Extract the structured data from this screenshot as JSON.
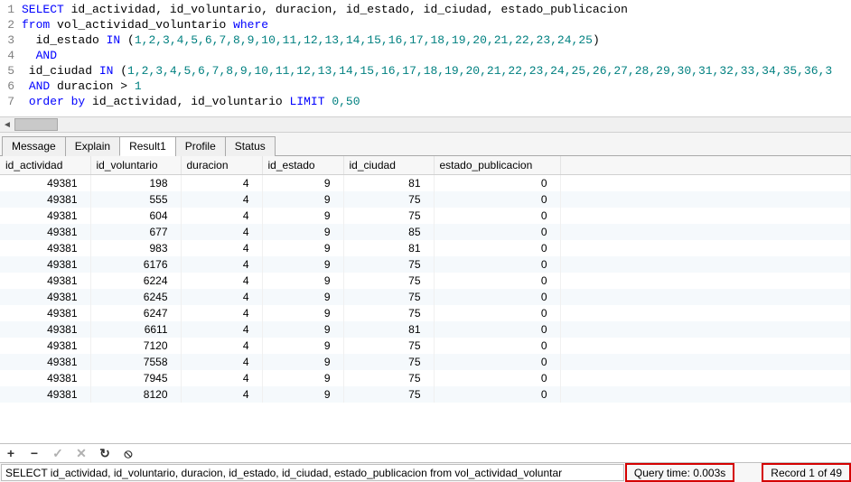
{
  "sql_lines": [
    {
      "n": "1",
      "tokens": [
        {
          "t": "SELECT",
          "c": "kw"
        },
        {
          "t": " id_actividad, id_voluntario, duracion, id_estado, id_ciudad, estado_publicacion"
        }
      ]
    },
    {
      "n": "2",
      "tokens": [
        {
          "t": "from",
          "c": "kw"
        },
        {
          "t": " vol_actividad_voluntario "
        },
        {
          "t": "where",
          "c": "kw"
        }
      ]
    },
    {
      "n": "3",
      "tokens": [
        {
          "t": "  id_estado "
        },
        {
          "t": "IN",
          "c": "kw"
        },
        {
          "t": " ("
        },
        {
          "t": "1,2,3,4,5,6,7,8,9,10,11,12,13,14,15,16,17,18,19,20,21,22,23,24,25",
          "c": "num"
        },
        {
          "t": ")"
        }
      ]
    },
    {
      "n": "4",
      "tokens": [
        {
          "t": "  "
        },
        {
          "t": "AND",
          "c": "kw"
        }
      ]
    },
    {
      "n": "5",
      "tokens": [
        {
          "t": " id_ciudad "
        },
        {
          "t": "IN",
          "c": "kw"
        },
        {
          "t": " ("
        },
        {
          "t": "1,2,3,4,5,6,7,8,9,10,11,12,13,14,15,16,17,18,19,20,21,22,23,24,25,26,27,28,29,30,31,32,33,34,35,36,3",
          "c": "num"
        }
      ]
    },
    {
      "n": "6",
      "tokens": [
        {
          "t": " "
        },
        {
          "t": "AND",
          "c": "kw"
        },
        {
          "t": " duracion > "
        },
        {
          "t": "1",
          "c": "num"
        }
      ]
    },
    {
      "n": "7",
      "tokens": [
        {
          "t": " "
        },
        {
          "t": "order by",
          "c": "kw"
        },
        {
          "t": " id_actividad, id_voluntario "
        },
        {
          "t": "LIMIT",
          "c": "kw"
        },
        {
          "t": " "
        },
        {
          "t": "0,50",
          "c": "num"
        }
      ]
    }
  ],
  "tabs": [
    {
      "label": "Message",
      "active": false
    },
    {
      "label": "Explain",
      "active": false
    },
    {
      "label": "Result1",
      "active": true
    },
    {
      "label": "Profile",
      "active": false
    },
    {
      "label": "Status",
      "active": false
    }
  ],
  "columns": [
    "id_actividad",
    "id_voluntario",
    "duracion",
    "id_estado",
    "id_ciudad",
    "estado_publicacion"
  ],
  "rows": [
    [
      49381,
      198,
      4,
      9,
      81,
      0
    ],
    [
      49381,
      555,
      4,
      9,
      75,
      0
    ],
    [
      49381,
      604,
      4,
      9,
      75,
      0
    ],
    [
      49381,
      677,
      4,
      9,
      85,
      0
    ],
    [
      49381,
      983,
      4,
      9,
      81,
      0
    ],
    [
      49381,
      6176,
      4,
      9,
      75,
      0
    ],
    [
      49381,
      6224,
      4,
      9,
      75,
      0
    ],
    [
      49381,
      6245,
      4,
      9,
      75,
      0
    ],
    [
      49381,
      6247,
      4,
      9,
      75,
      0
    ],
    [
      49381,
      6611,
      4,
      9,
      81,
      0
    ],
    [
      49381,
      7120,
      4,
      9,
      75,
      0
    ],
    [
      49381,
      7558,
      4,
      9,
      75,
      0
    ],
    [
      49381,
      7945,
      4,
      9,
      75,
      0
    ],
    [
      49381,
      8120,
      4,
      9,
      75,
      0
    ]
  ],
  "toolbar_icons": [
    "+",
    "−",
    "✓",
    "✕",
    "↻",
    "⦸"
  ],
  "status": {
    "query_text": "SELECT id_actividad, id_voluntario, duracion, id_estado, id_ciudad, estado_publicacion  from vol_actividad_voluntar",
    "query_time": "Query time: 0.003s",
    "record": "Record 1 of 49"
  }
}
